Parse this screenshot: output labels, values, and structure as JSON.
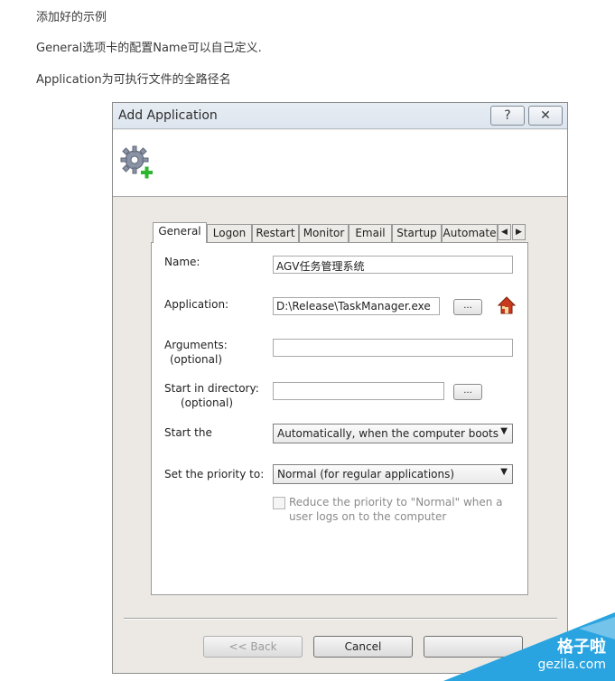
{
  "article": {
    "line1": "添加好的示例",
    "line2": "General选项卡的配置Name可以自己定义.",
    "line3": "Application为可执行文件的全路径名"
  },
  "dialog": {
    "title": "Add Application",
    "help_label": "?",
    "close_label": "✕"
  },
  "tabs": [
    {
      "label": "General"
    },
    {
      "label": "Logon"
    },
    {
      "label": "Restart"
    },
    {
      "label": "Monitor"
    },
    {
      "label": "Email"
    },
    {
      "label": "Startup"
    },
    {
      "label": "Automate"
    }
  ],
  "tab_scroll": {
    "left": "◀",
    "right": "▶"
  },
  "form": {
    "name_label": "Name:",
    "name_value": "AGV任务管理系统",
    "application_label": "Application:",
    "application_value": "D:\\Release\\TaskManager.exe",
    "browse_label": "...",
    "arguments_label": "Arguments:",
    "arguments_optional": "(optional)",
    "arguments_value": "",
    "startdir_label": "Start in directory:",
    "startdir_optional": "(optional)",
    "startdir_value": "",
    "start_label": "Start the",
    "start_value": "Automatically, when the computer boots",
    "priority_label": "Set the priority to:",
    "priority_value": "Normal (for regular applications)",
    "reduce_label_line1": "Reduce the priority to \"Normal\" when a",
    "reduce_label_line2": "user logs on to the computer"
  },
  "buttons": {
    "back": "<< Back",
    "cancel": "Cancel"
  },
  "watermark": {
    "text1": "格子啦",
    "text2": "gezila.com"
  },
  "colors": {
    "watermark_blue": "#2aa4e0",
    "icon_green": "#2db52d"
  }
}
